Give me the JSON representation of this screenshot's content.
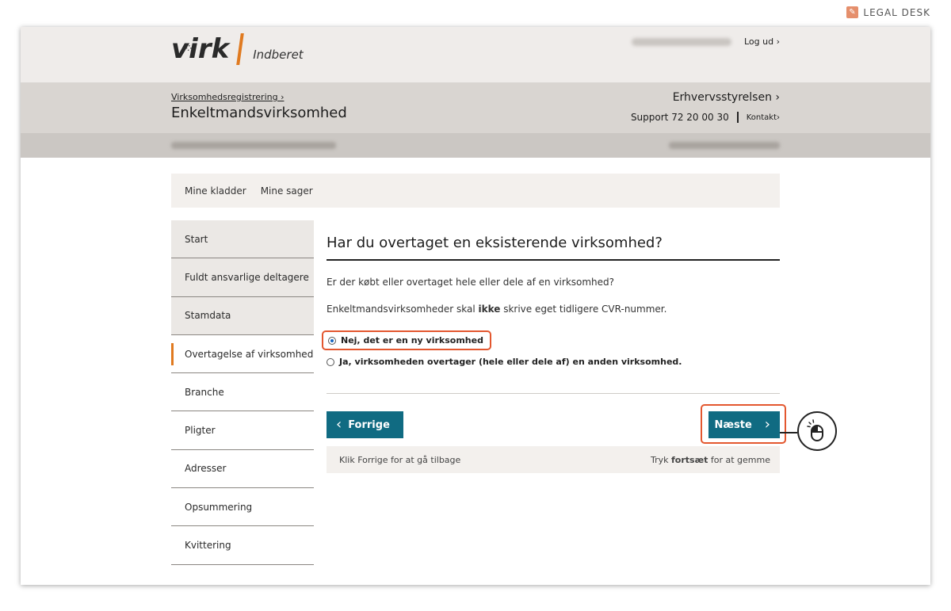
{
  "brand": {
    "corner_label": "LEGAL DESK",
    "logo_text": "virk",
    "logo_sub": "Indberet",
    "accent": "#e07a20"
  },
  "header": {
    "logout": "Log ud ›"
  },
  "subheader": {
    "breadcrumb": "Virksomhedsregistrering ›",
    "title": "Enkeltmandsvirksomhed",
    "org": "Erhvervsstyrelsen ›",
    "support": "Support 72 20 00 30",
    "contact": "Kontakt›"
  },
  "tabs": [
    "Mine kladder",
    "Mine sager"
  ],
  "sidenav": [
    "Start",
    "Fuldt ansvarlige deltagere",
    "Stamdata",
    "Overtagelse af virksomhed",
    "Branche",
    "Pligter",
    "Adresser",
    "Opsummering",
    "Kvittering"
  ],
  "sidenav_active": "Overtagelse af virksomhed",
  "main": {
    "heading": "Har du overtaget en eksisterende virksomhed?",
    "question": "Er der købt eller overtaget hele eller dele af en virksomhed?",
    "note_before": "Enkeltmandsvirksomheder skal ",
    "note_bold": "ikke",
    "note_after": " skrive eget tidligere CVR-nummer.",
    "option_no": "Nej, det er en ny virksomhed",
    "option_yes": "Ja, virksomheden overtager (hele eller dele af) en anden virksomhed.",
    "selected": "option_no",
    "prev_label": "Forrige",
    "next_label": "Næste",
    "hint_left": "Klik Forrige for at gå tilbage",
    "hint_right_before": "Tryk ",
    "hint_right_bold": "fortsæt",
    "hint_right_after": " for at gemme"
  },
  "colors": {
    "button": "#106b82",
    "highlight": "#e3572f"
  }
}
